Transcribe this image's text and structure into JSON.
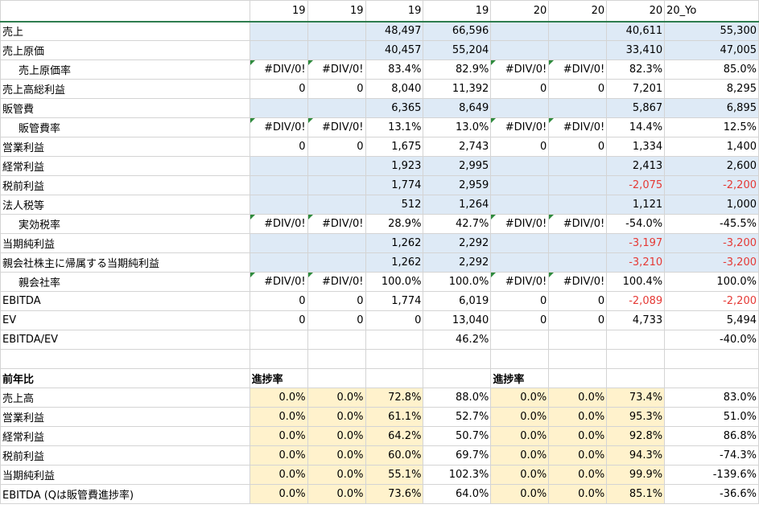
{
  "header": [
    "",
    "19",
    "19",
    "19",
    "19",
    "20",
    "20",
    "20",
    "20_Yo"
  ],
  "rows": [
    {
      "label": "売上",
      "bg": "blue",
      "cells": [
        "",
        "",
        "48,497",
        "66,596",
        "",
        "",
        "40,611",
        "55,300"
      ]
    },
    {
      "label": "売上原価",
      "bg": "blue",
      "cells": [
        "",
        "",
        "40,457",
        "55,204",
        "",
        "",
        "33,410",
        "47,005"
      ]
    },
    {
      "label": "売上原価率",
      "indent": true,
      "err": true,
      "cells": [
        "#DIV/0!",
        "#DIV/0!",
        "83.4%",
        "82.9%",
        "#DIV/0!",
        "#DIV/0!",
        "82.3%",
        "85.0%"
      ]
    },
    {
      "label": "売上高総利益",
      "cells": [
        "0",
        "0",
        "8,040",
        "11,392",
        "0",
        "0",
        "7,201",
        "8,295"
      ]
    },
    {
      "label": "販管費",
      "bg": "blue",
      "cells": [
        "",
        "",
        "6,365",
        "8,649",
        "",
        "",
        "5,867",
        "6,895"
      ]
    },
    {
      "label": "販管費率",
      "indent": true,
      "err": true,
      "cells": [
        "#DIV/0!",
        "#DIV/0!",
        "13.1%",
        "13.0%",
        "#DIV/0!",
        "#DIV/0!",
        "14.4%",
        "12.5%"
      ]
    },
    {
      "label": "営業利益",
      "cells": [
        "0",
        "0",
        "1,675",
        "2,743",
        "0",
        "0",
        "1,334",
        "1,400"
      ]
    },
    {
      "label": "経常利益",
      "bg": "blue",
      "cells": [
        "",
        "",
        "1,923",
        "2,995",
        "",
        "",
        "2,413",
        "2,600"
      ]
    },
    {
      "label": "税前利益",
      "bg": "blue",
      "cells": [
        "",
        "",
        "1,774",
        "2,959",
        "",
        "",
        "-2,075",
        "-2,200"
      ],
      "neg": [
        6,
        7
      ]
    },
    {
      "label": "法人税等",
      "bg": "blue",
      "cells": [
        "",
        "",
        "512",
        "1,264",
        "",
        "",
        "1,121",
        "1,000"
      ]
    },
    {
      "label": "実効税率",
      "indent": true,
      "err": true,
      "cells": [
        "#DIV/0!",
        "#DIV/0!",
        "28.9%",
        "42.7%",
        "#DIV/0!",
        "#DIV/0!",
        "-54.0%",
        "-45.5%"
      ]
    },
    {
      "label": "当期純利益",
      "bg": "blue",
      "cells": [
        "",
        "",
        "1,262",
        "2,292",
        "",
        "",
        "-3,197",
        "-3,200"
      ],
      "neg": [
        6,
        7
      ]
    },
    {
      "label": "親会社株主に帰属する当期純利益",
      "bg": "blue",
      "cells": [
        "",
        "",
        "1,262",
        "2,292",
        "",
        "",
        "-3,210",
        "-3,200"
      ],
      "neg": [
        6,
        7
      ]
    },
    {
      "label": "親会社率",
      "indent": true,
      "err": true,
      "cells": [
        "#DIV/0!",
        "#DIV/0!",
        "100.0%",
        "100.0%",
        "#DIV/0!",
        "#DIV/0!",
        "100.4%",
        "100.0%"
      ]
    },
    {
      "label": "EBITDA",
      "cells": [
        "0",
        "0",
        "1,774",
        "6,019",
        "0",
        "0",
        "-2,089",
        "-2,200"
      ],
      "neg": [
        6,
        7
      ]
    },
    {
      "label": "EV",
      "cells": [
        "0",
        "0",
        "0",
        "13,040",
        "0",
        "0",
        "4,733",
        "5,494"
      ]
    },
    {
      "label": "EBITDA/EV",
      "cells": [
        "",
        "",
        "",
        "46.2%",
        "",
        "",
        "",
        "-40.0%"
      ]
    },
    {
      "label": "",
      "cells": [
        "",
        "",
        "",
        "",
        "",
        "",
        "",
        ""
      ]
    },
    {
      "label": "前年比",
      "bold": true,
      "section": true,
      "cells": [
        "進捗率",
        "",
        "",
        "",
        "進捗率",
        "",
        "",
        ""
      ]
    },
    {
      "label": "売上高",
      "bg": "yellow",
      "cells": [
        "0.0%",
        "0.0%",
        "72.8%",
        "88.0%",
        "0.0%",
        "0.0%",
        "73.4%",
        "83.0%"
      ]
    },
    {
      "label": "営業利益",
      "bg": "yellow",
      "cells": [
        "0.0%",
        "0.0%",
        "61.1%",
        "52.7%",
        "0.0%",
        "0.0%",
        "95.3%",
        "51.0%"
      ]
    },
    {
      "label": "経常利益",
      "bg": "yellow",
      "cells": [
        "0.0%",
        "0.0%",
        "64.2%",
        "50.7%",
        "0.0%",
        "0.0%",
        "92.8%",
        "86.8%"
      ]
    },
    {
      "label": "税前利益",
      "bg": "yellow",
      "cells": [
        "0.0%",
        "0.0%",
        "60.0%",
        "69.7%",
        "0.0%",
        "0.0%",
        "94.3%",
        "-74.3%"
      ]
    },
    {
      "label": "当期純利益",
      "bg": "yellow",
      "cells": [
        "0.0%",
        "0.0%",
        "55.1%",
        "102.3%",
        "0.0%",
        "0.0%",
        "99.9%",
        "-139.6%"
      ]
    },
    {
      "label": "EBITDA (Qは販管費進捗率)",
      "bg": "yellow",
      "cells": [
        "0.0%",
        "0.0%",
        "73.6%",
        "64.0%",
        "0.0%",
        "0.0%",
        "85.1%",
        "-36.6%"
      ]
    }
  ],
  "colors": {
    "blue": "#deeaf6",
    "yellow": "#fff2cc",
    "negative": "#e53935",
    "error_marker": "#2e8b3d"
  }
}
